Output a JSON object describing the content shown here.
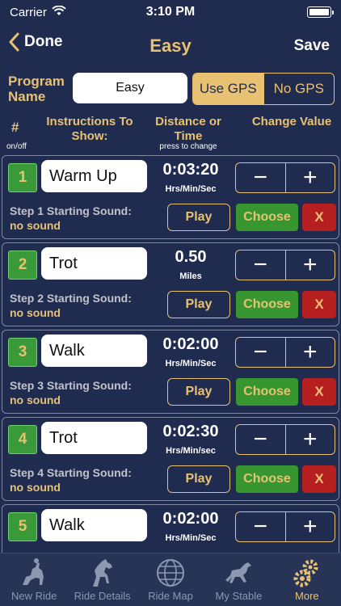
{
  "status_bar": {
    "carrier": "Carrier",
    "time": "3:10 PM"
  },
  "nav": {
    "back_label": "Done",
    "title": "Easy",
    "save_label": "Save"
  },
  "program": {
    "label": "Program Name",
    "name_value": "Easy",
    "gps_on_label": "Use GPS",
    "gps_off_label": "No GPS",
    "gps_selected": "Use GPS"
  },
  "columns": {
    "num": "#",
    "onoff": "on/off",
    "instructions": "Instructions To Show:",
    "distance": "Distance or Time",
    "press_hint": "press to change",
    "change": "Change Value"
  },
  "stepper": {
    "minus": "−",
    "plus": "+"
  },
  "steps": [
    {
      "num": "1",
      "name": "Warm Up",
      "value": "0:03:20",
      "unit": "Hrs/Min/Sec",
      "sound_label": "Step 1 Starting Sound:",
      "sound_value": "no sound",
      "play": "Play",
      "choose": "Choose",
      "remove": "X"
    },
    {
      "num": "2",
      "name": "Trot",
      "value": "0.50",
      "unit": "Miles",
      "sound_label": "Step 2 Starting Sound:",
      "sound_value": "no sound",
      "play": "Play",
      "choose": "Choose",
      "remove": "X"
    },
    {
      "num": "3",
      "name": "Walk",
      "value": "0:02:00",
      "unit": "Hrs/Min/Sec",
      "sound_label": "Step 3 Starting Sound:",
      "sound_value": "no sound",
      "play": "Play",
      "choose": "Choose",
      "remove": "X"
    },
    {
      "num": "4",
      "name": "Trot",
      "value": "0:02:30",
      "unit": "Hrs/Min/sec",
      "sound_label": "Step 4 Starting Sound:",
      "sound_value": "no sound",
      "play": "Play",
      "choose": "Choose",
      "remove": "X"
    },
    {
      "num": "5",
      "name": "Walk",
      "value": "0:02:00",
      "unit": "Hrs/Min/Sec"
    }
  ],
  "tabs": [
    {
      "label": "New Ride",
      "icon": "rider-icon"
    },
    {
      "label": "Ride Details",
      "icon": "horse-icon"
    },
    {
      "label": "Ride Map",
      "icon": "globe-icon"
    },
    {
      "label": "My Stable",
      "icon": "horse-running-icon"
    },
    {
      "label": "More",
      "icon": "gears-icon",
      "active": true
    }
  ],
  "colors": {
    "background": "#1f2b4f",
    "accent": "#e8c173",
    "green": "#37962f",
    "red": "#b51f1f"
  }
}
